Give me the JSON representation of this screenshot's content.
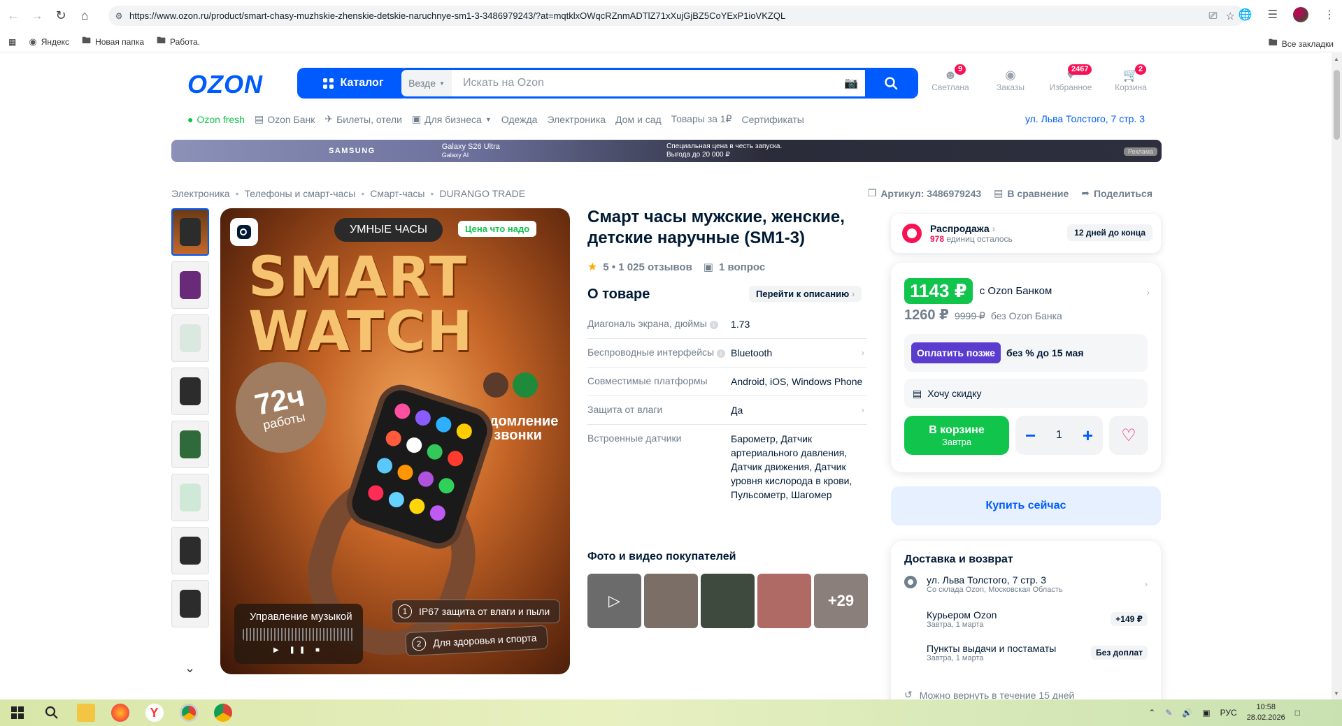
{
  "browser": {
    "url": "https://www.ozon.ru/product/smart-chasy-muzhskie-zhenskie-detskie-naruchnye-sm1-3-3486979243/?at=mqtklxOWqcRZnmADTlZ71xXujGjBZ5CoYExP1ioVKZQL",
    "bookmarks": [
      "Яндекс",
      "Новая папка",
      "Работа."
    ],
    "all_bookmarks": "Все закладки"
  },
  "header": {
    "logo": "OZON",
    "catalog": "Каталог",
    "search_scope": "Везде",
    "search_placeholder": "Искать на Ozon",
    "actions": [
      {
        "label": "Светлана",
        "badge": "9"
      },
      {
        "label": "Заказы",
        "badge": ""
      },
      {
        "label": "Избранное",
        "badge": "2467"
      },
      {
        "label": "Корзина",
        "badge": "2"
      }
    ]
  },
  "subnav": {
    "items": [
      "Ozon fresh",
      "Ozon Банк",
      "Билеты, отели",
      "Для бизнеса",
      "Одежда",
      "Электроника",
      "Дом и сад",
      "Товары за 1₽",
      "Сертификаты"
    ],
    "address": "ул. Льва Толстого, 7 стр. 3"
  },
  "banner": {
    "brand": "SAMSUNG",
    "model": "Galaxy S26 Ultra",
    "model_sub": "Galaxy AI",
    "offer_1": "Специальная цена в честь запуска.",
    "offer_2": "Выгода до 20 000 ₽",
    "ad": "Реклама"
  },
  "breadcrumbs": [
    "Электроника",
    "Телефоны и смарт-часы",
    "Смарт-часы",
    "DURANGO TRADE"
  ],
  "crumb_actions": {
    "article": "Артикул: 3486979243",
    "compare": "В сравнение",
    "share": "Поделиться"
  },
  "image": {
    "pill": "УМНЫЕ ЧАСЫ",
    "price_tag": "Цена что надо",
    "title_1": "SMART",
    "title_2": "WATCH",
    "hours_big": "72ч",
    "hours_small": "работы",
    "notify_1": "Уведомление",
    "notify_2": "и звонки",
    "music": "Управление музыкой",
    "feature_1": "IP67 защита от влаги и пыли",
    "feature_2": "Для здоровья и спорта",
    "feature_1_num": "1",
    "feature_2_num": "2"
  },
  "product": {
    "title": "Смарт часы мужские, женские, детские наручные (SM1-3)",
    "rating": "5 • 1 025 отзывов",
    "questions": "1 вопрос",
    "about": "О товаре",
    "goto_desc": "Перейти к описанию",
    "specs": [
      {
        "key": "Диагональ экрана, дюймы",
        "value": "1.73"
      },
      {
        "key": "Беспроводные интерфейсы",
        "value": "Bluetooth"
      },
      {
        "key": "Совместимые платформы",
        "value": "Android, iOS, Windows Phone"
      },
      {
        "key": "Защита от влаги",
        "value": "Да"
      },
      {
        "key": "Встроенные датчики",
        "value": "Барометр, Датчик артериального давления, Датчик движения, Датчик уровня кислорода в крови, Пульсометр, Шагомер"
      }
    ],
    "photos_head": "Фото и видео покупателей",
    "photos_more": "+29"
  },
  "sale": {
    "title": "Распродажа",
    "count": "978",
    "count_suffix": "единиц осталось",
    "days": "12 дней до конца"
  },
  "price": {
    "main": "1143 ₽",
    "with_bank": "с Ozon Банком",
    "second": "1260 ₽",
    "old": "9999 ₽",
    "without_bank": "без Ozon Банка",
    "pay_later": "Оплатить позже",
    "pay_later_text": "без % до 15 мая",
    "want_discount": "Хочу скидку",
    "in_cart": "В корзине",
    "in_cart_sub": "Завтра",
    "qty": "1",
    "buy_now": "Купить сейчас"
  },
  "delivery": {
    "title": "Доставка и возврат",
    "address": "ул. Льва Толстого, 7 стр. 3",
    "address_sub": "Со склада Ozon, Московская Область",
    "courier": "Курьером Ozon",
    "courier_sub": "Завтра, 1 марта",
    "courier_price": "+149 ₽",
    "pickup": "Пункты выдачи и постаматы",
    "pickup_sub": "Завтра, 1 марта",
    "pickup_price": "Без доплат",
    "return": "Можно вернуть в течение 15 дней"
  },
  "taskbar": {
    "lang": "РУС",
    "time": "10:58",
    "date": "28.02.2026"
  }
}
